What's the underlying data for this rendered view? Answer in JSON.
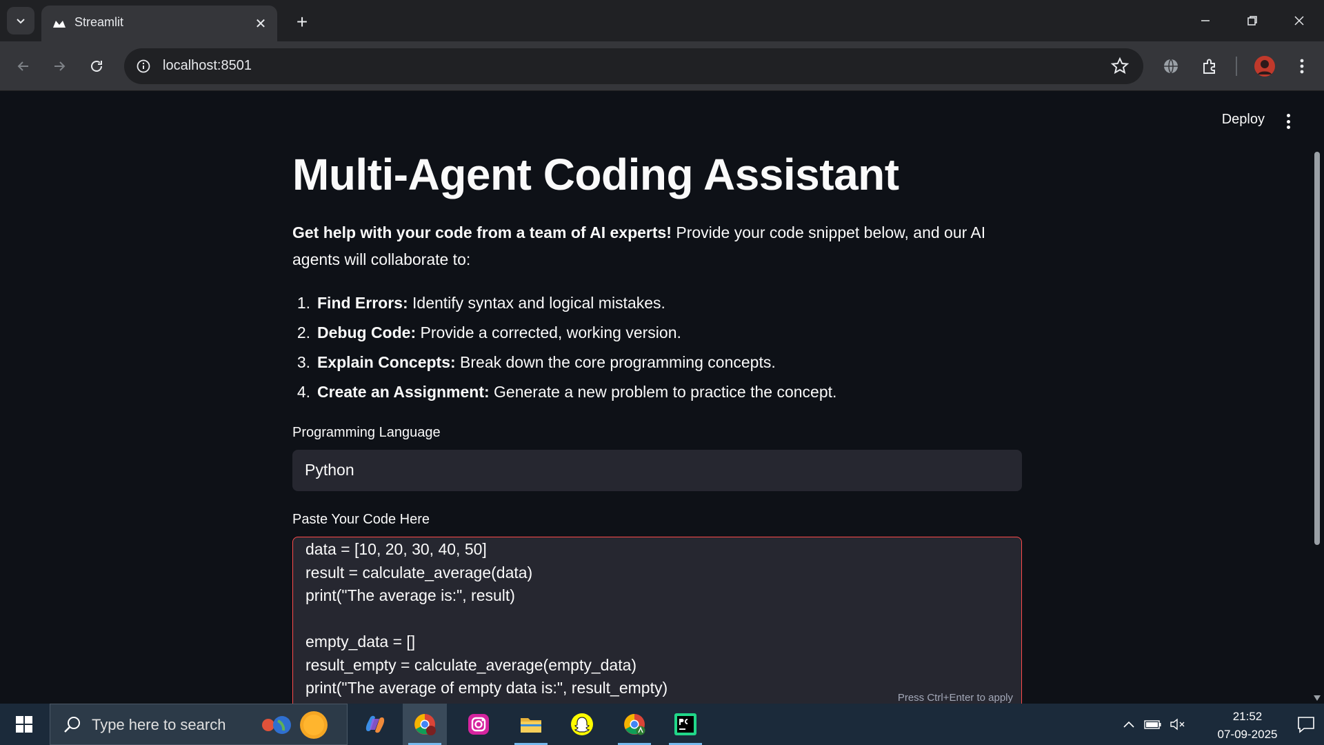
{
  "browser": {
    "tab_title": "Streamlit",
    "url": "localhost:8501"
  },
  "app": {
    "deploy_label": "Deploy",
    "title": "Multi-Agent Coding Assistant",
    "intro_bold": "Get help with your code from a team of AI experts!",
    "intro_rest": " Provide your code snippet below, and our AI agents will collaborate to:",
    "steps": [
      {
        "num": "1.",
        "bold": "Find Errors:",
        "text": " Identify syntax and logical mistakes."
      },
      {
        "num": "2.",
        "bold": "Debug Code:",
        "text": " Provide a corrected, working version."
      },
      {
        "num": "3.",
        "bold": "Explain Concepts:",
        "text": " Break down the core programming concepts."
      },
      {
        "num": "4.",
        "bold": "Create an Assignment:",
        "text": " Generate a new problem to practice the concept."
      }
    ],
    "language_label": "Programming Language",
    "language_value": "Python",
    "code_label": "Paste Your Code Here",
    "code_lines": [
      "data = [10, 20, 30, 40, 50]",
      "result = calculate_average(data)",
      "print(\"The average is:\", result)",
      "",
      "empty_data = []",
      "result_empty = calculate_average(empty_data)",
      "print(\"The average of empty data is:\", result_empty)"
    ],
    "code_hint": "Press Ctrl+Enter to apply"
  },
  "taskbar": {
    "search_placeholder": "Type here to search",
    "time": "21:52",
    "date": "07-09-2025"
  },
  "colors": {
    "accent": "#ff4b4b",
    "background": "#0e1117",
    "input_bg": "#262730"
  }
}
